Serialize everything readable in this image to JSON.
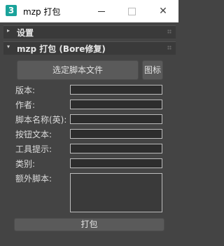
{
  "window": {
    "app_icon_glyph": "3",
    "title": "mzp 打包",
    "minimize_icon": "minimize-icon",
    "maximize_icon": "maximize-icon",
    "close_glyph": "✕"
  },
  "rollouts": [
    {
      "arrow": "▸",
      "label": "设置",
      "expanded": false
    },
    {
      "arrow": "▾",
      "label": "mzp 打包 (Bore修复)",
      "expanded": true
    }
  ],
  "pack_panel": {
    "select_script_label": "选定脚本文件",
    "icon_label": "图标",
    "fields": [
      {
        "label": "版本:",
        "value": ""
      },
      {
        "label": "作者:",
        "value": ""
      },
      {
        "label": "脚本名称(英):",
        "value": ""
      },
      {
        "label": "按钮文本:",
        "value": ""
      },
      {
        "label": "工具提示:",
        "value": ""
      },
      {
        "label": "类别:",
        "value": ""
      }
    ],
    "extra_scripts_label": "额外脚本:",
    "extra_scripts_value": "",
    "pack_button_label": "打包"
  },
  "colors": {
    "background": "#444444",
    "rollout_header": "#3a3a3a",
    "button": "#5a5a5a",
    "field": "#2d2d2d",
    "app_icon": "#1aa39b"
  }
}
